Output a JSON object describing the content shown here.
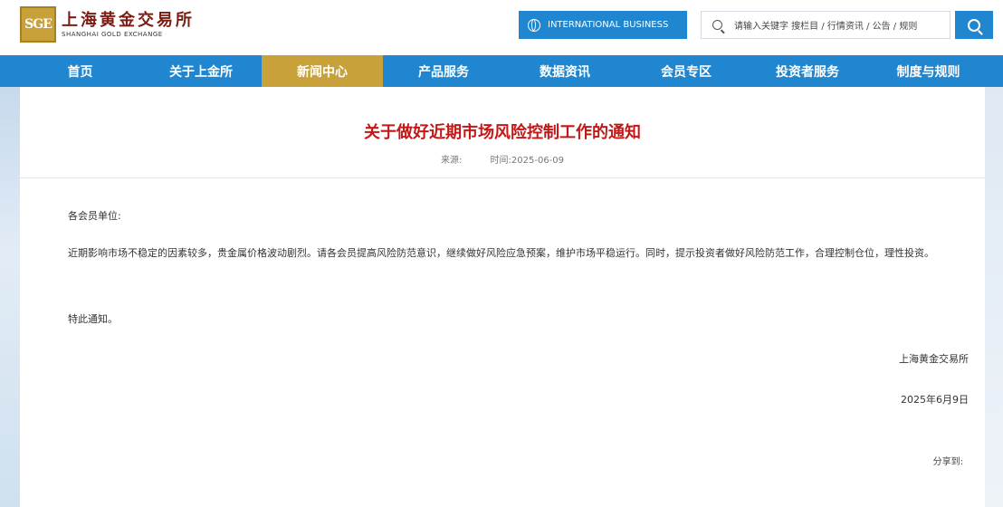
{
  "header": {
    "logo_mark": "SGE",
    "logo_cn": "上海黄金交易所",
    "logo_en": "SHANGHAI GOLD EXCHANGE",
    "intl_button": "INTERNATIONAL BUSINESS",
    "search_placeholder": "请输入关键字   搜栏目 / 行情资讯 / 公告 / 规则"
  },
  "nav": {
    "items": [
      {
        "label": "首页"
      },
      {
        "label": "关于上金所"
      },
      {
        "label": "新闻中心"
      },
      {
        "label": "产品服务"
      },
      {
        "label": "数据资讯"
      },
      {
        "label": "会员专区"
      },
      {
        "label": "投资者服务"
      },
      {
        "label": "制度与规则"
      }
    ],
    "active_index": 2
  },
  "article": {
    "title": "关于做好近期市场风险控制工作的通知",
    "source_label": "来源:",
    "time_label": "时间:2025-06-09",
    "salutation": "各会员单位:",
    "body": "近期影响市场不稳定的因素较多，贵金属价格波动剧烈。请各会员提高风险防范意识，继续做好风险应急预案，维护市场平稳运行。同时，提示投资者做好风险防范工作，合理控制仓位，理性投资。",
    "closing": "特此通知。",
    "signer": "上海黄金交易所",
    "date": "2025年6月9日",
    "share_label": "分享到:"
  },
  "colors": {
    "brand_blue": "#1f86cf",
    "active_gold": "#c9a13a",
    "title_red": "#c41717"
  }
}
